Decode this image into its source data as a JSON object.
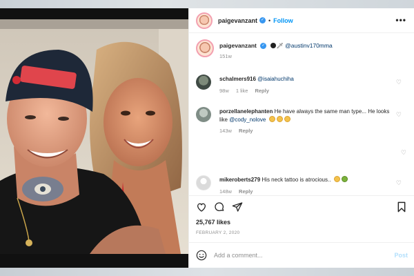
{
  "post": {
    "username": "paigevanzant",
    "follow_label": "Follow",
    "more_label": "•••"
  },
  "caption": {
    "username": "paigevanzant",
    "mention": "@austinv170mma",
    "age": "151w"
  },
  "comments": [
    {
      "username": "schalmers916",
      "text": "",
      "mention": "@isaiahuchiha",
      "age": "98w",
      "likes": "1 like",
      "reply": "Reply"
    },
    {
      "username": "porzellanelephanten",
      "text": "He have always the same man type... He looks like",
      "mention": "@cody_nolove",
      "age": "143w",
      "reply": "Reply"
    },
    {
      "username": "mikeroberts279",
      "text": "His neck tattoo is atrocious..",
      "age": "148w",
      "reply": "Reply"
    }
  ],
  "stats": {
    "likes": "25,767 likes",
    "date": "FEBRUARY 2, 2020"
  },
  "composer": {
    "placeholder": "Add a comment...",
    "post_label": "Post"
  },
  "icons": {
    "like": "heart-icon",
    "comment": "comment-icon",
    "share": "share-icon",
    "save": "bookmark-icon",
    "emoji": "smiley-icon",
    "verified": "verified-badge-icon"
  },
  "colors": {
    "accent": "#0095f6",
    "verified": "#3897f0",
    "muted": "#8e8e8e",
    "post_disabled": "#b2dffc"
  }
}
